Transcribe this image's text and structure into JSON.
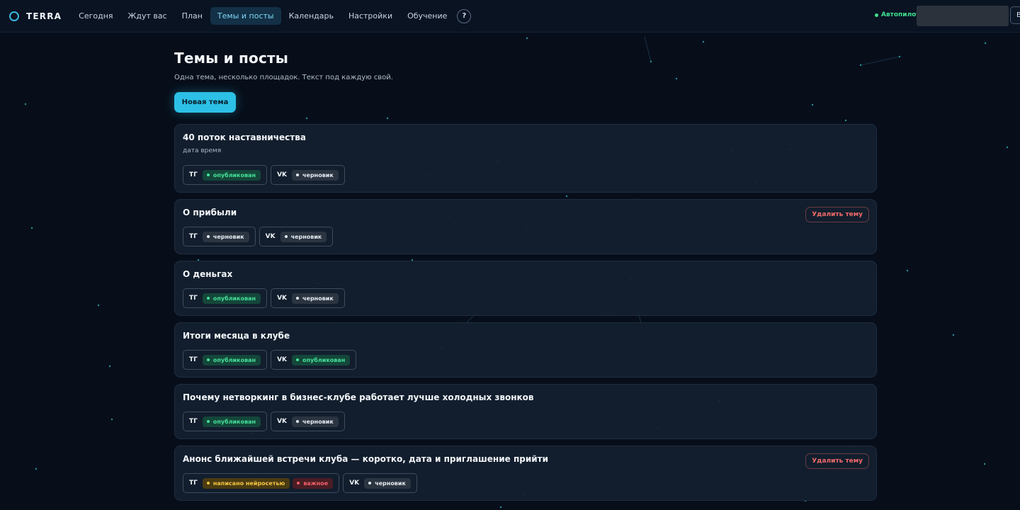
{
  "header": {
    "logo_text": "TERRA",
    "nav": [
      {
        "label": "Сегодня",
        "active": false
      },
      {
        "label": "Ждут вас",
        "active": false
      },
      {
        "label": "План",
        "active": false
      },
      {
        "label": "Темы и посты",
        "active": true
      },
      {
        "label": "Календарь",
        "active": false
      },
      {
        "label": "Настройки",
        "active": false
      },
      {
        "label": "Обучение",
        "active": false
      }
    ],
    "help_label": "?",
    "autopilot_label": "Автопилот",
    "corner_button_label": "В"
  },
  "page": {
    "title": "Темы и посты",
    "subtitle": "Одна тема, несколько площадок. Текст под каждую свой.",
    "new_topic_label": "Новая тема",
    "delete_label": "Удалить тему"
  },
  "topics": [
    {
      "title": "40 поток наставничества",
      "subtitle": "дата время",
      "deletable": false,
      "platforms": [
        {
          "name": "ТГ",
          "badges": [
            {
              "label": "опубликован",
              "type": "published"
            }
          ]
        },
        {
          "name": "VK",
          "badges": [
            {
              "label": "черновик",
              "type": "draft"
            }
          ]
        }
      ]
    },
    {
      "title": "О прибыли",
      "subtitle": "",
      "deletable": true,
      "platforms": [
        {
          "name": "ТГ",
          "badges": [
            {
              "label": "черновик",
              "type": "draft"
            }
          ]
        },
        {
          "name": "VK",
          "badges": [
            {
              "label": "черновик",
              "type": "draft"
            }
          ]
        }
      ]
    },
    {
      "title": "О деньгах",
      "subtitle": "",
      "deletable": false,
      "platforms": [
        {
          "name": "ТГ",
          "badges": [
            {
              "label": "опубликован",
              "type": "published"
            }
          ]
        },
        {
          "name": "VK",
          "badges": [
            {
              "label": "черновик",
              "type": "draft"
            }
          ]
        }
      ]
    },
    {
      "title": "Итоги месяца в клубе",
      "subtitle": "",
      "deletable": false,
      "platforms": [
        {
          "name": "ТГ",
          "badges": [
            {
              "label": "опубликован",
              "type": "published"
            }
          ]
        },
        {
          "name": "VK",
          "badges": [
            {
              "label": "опубликован",
              "type": "published"
            }
          ]
        }
      ]
    },
    {
      "title": "Почему нетворкинг в бизнес-клубе работает лучше холодных звонков",
      "subtitle": "",
      "deletable": false,
      "platforms": [
        {
          "name": "ТГ",
          "badges": [
            {
              "label": "опубликован",
              "type": "published"
            }
          ]
        },
        {
          "name": "VK",
          "badges": [
            {
              "label": "черновик",
              "type": "draft"
            }
          ]
        }
      ]
    },
    {
      "title": "Анонс ближайшей встречи клуба — коротко, дата и приглашение прийти",
      "subtitle": "",
      "deletable": true,
      "platforms": [
        {
          "name": "ТГ",
          "badges": [
            {
              "label": "написано нейросетью",
              "type": "ai"
            },
            {
              "label": "важное",
              "type": "important"
            }
          ]
        },
        {
          "name": "VK",
          "badges": [
            {
              "label": "черновик",
              "type": "draft"
            }
          ]
        }
      ]
    }
  ],
  "colors": {
    "background": "#070e1a",
    "accent": "#2cc0e6",
    "published": "#45e29a",
    "ai_generated": "#f4c542",
    "important": "#f0606a",
    "autopilot": "#3fe08d"
  }
}
